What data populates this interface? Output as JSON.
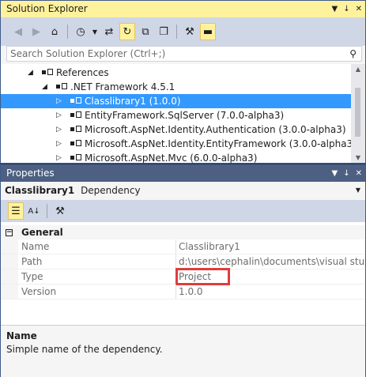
{
  "solution_explorer": {
    "title": "Solution Explorer",
    "pin_glyph": "↓",
    "close_glyph": "✕",
    "menu_glyph": "▼",
    "search_placeholder": "Search Solution Explorer (Ctrl+;)",
    "tree": [
      {
        "label": "References",
        "expander": "◢",
        "icon": "reference-icon",
        "selected": false
      },
      {
        "label": ".NET Framework 4.5.1",
        "expander": "◢",
        "icon": "reference-icon",
        "selected": false
      },
      {
        "label": "Classlibrary1 (1.0.0)",
        "expander": "▷",
        "icon": "reference-icon",
        "selected": true
      },
      {
        "label": "EntityFramework.SqlServer (7.0.0-alpha3)",
        "expander": "▷",
        "icon": "reference-icon",
        "selected": false
      },
      {
        "label": "Microsoft.AspNet.Identity.Authentication (3.0.0-alpha3)",
        "expander": "▷",
        "icon": "reference-icon",
        "selected": false
      },
      {
        "label": "Microsoft.AspNet.Identity.EntityFramework (3.0.0-alpha3)",
        "expander": "▷",
        "icon": "reference-icon",
        "selected": false
      },
      {
        "label": "Microsoft.AspNet.Mvc (6.0.0-alpha3)",
        "expander": "▷",
        "icon": "reference-icon",
        "selected": false
      }
    ]
  },
  "properties": {
    "title": "Properties",
    "pin_glyph": "↓",
    "close_glyph": "✕",
    "menu_glyph": "▼",
    "object_name": "Classlibrary1",
    "object_type": "Dependency",
    "category": "General",
    "collapse_glyph": "−",
    "rows": [
      {
        "name": "Name",
        "value": "Classlibrary1"
      },
      {
        "name": "Path",
        "value": "d:\\users\\cephalin\\documents\\visual studio"
      },
      {
        "name": "Type",
        "value": "Project"
      },
      {
        "name": "Version",
        "value": "1.0.0"
      }
    ],
    "description_title": "Name",
    "description_text": "Simple name of the dependency."
  }
}
